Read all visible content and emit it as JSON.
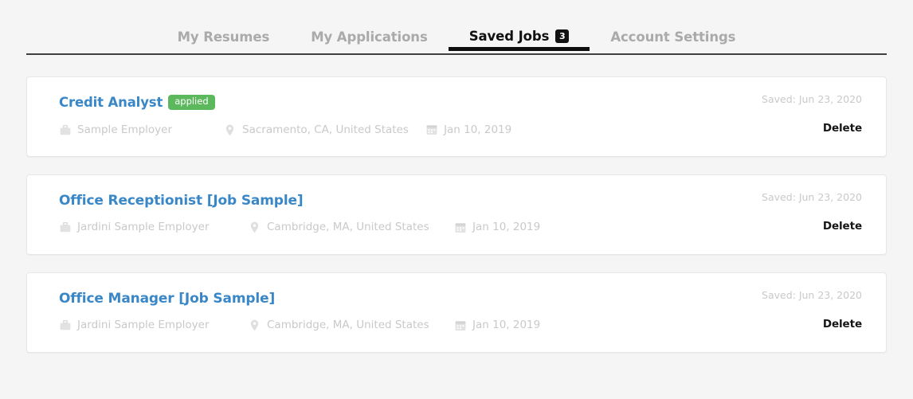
{
  "tabs": [
    {
      "label": "My Resumes",
      "active": false,
      "badge": null
    },
    {
      "label": "My Applications",
      "active": false,
      "badge": null
    },
    {
      "label": "Saved Jobs",
      "active": true,
      "badge": "3"
    },
    {
      "label": "Account Settings",
      "active": false,
      "badge": null
    }
  ],
  "colors": {
    "page_background": "#f5f5f5",
    "card_background": "#ffffff",
    "title_link": "#3a87c8",
    "badge_applied": "#5cb85c",
    "active_tab": "#111111",
    "inactive_tab": "#aaaaaa",
    "meta_text": "#c9c9c9",
    "delete_text": "#151515"
  },
  "jobs": [
    {
      "title": "Credit Analyst",
      "status_badge": "applied",
      "employer": "Sample Employer",
      "location": "Sacramento, CA, United States",
      "date": "Jan 10, 2019",
      "saved": "Saved: Jun 23, 2020",
      "delete_label": "Delete"
    },
    {
      "title": "Office Receptionist [Job Sample]",
      "status_badge": null,
      "employer": "Jardini Sample Employer",
      "location": "Cambridge, MA, United States",
      "date": "Jan 10, 2019",
      "saved": "Saved: Jun 23, 2020",
      "delete_label": "Delete"
    },
    {
      "title": "Office Manager [Job Sample]",
      "status_badge": null,
      "employer": "Jardini Sample Employer",
      "location": "Cambridge, MA, United States",
      "date": "Jan 10, 2019",
      "saved": "Saved: Jun 23, 2020",
      "delete_label": "Delete"
    }
  ],
  "icons": {
    "employer": "briefcase-icon",
    "location": "map-pin-icon",
    "date": "calendar-icon"
  }
}
